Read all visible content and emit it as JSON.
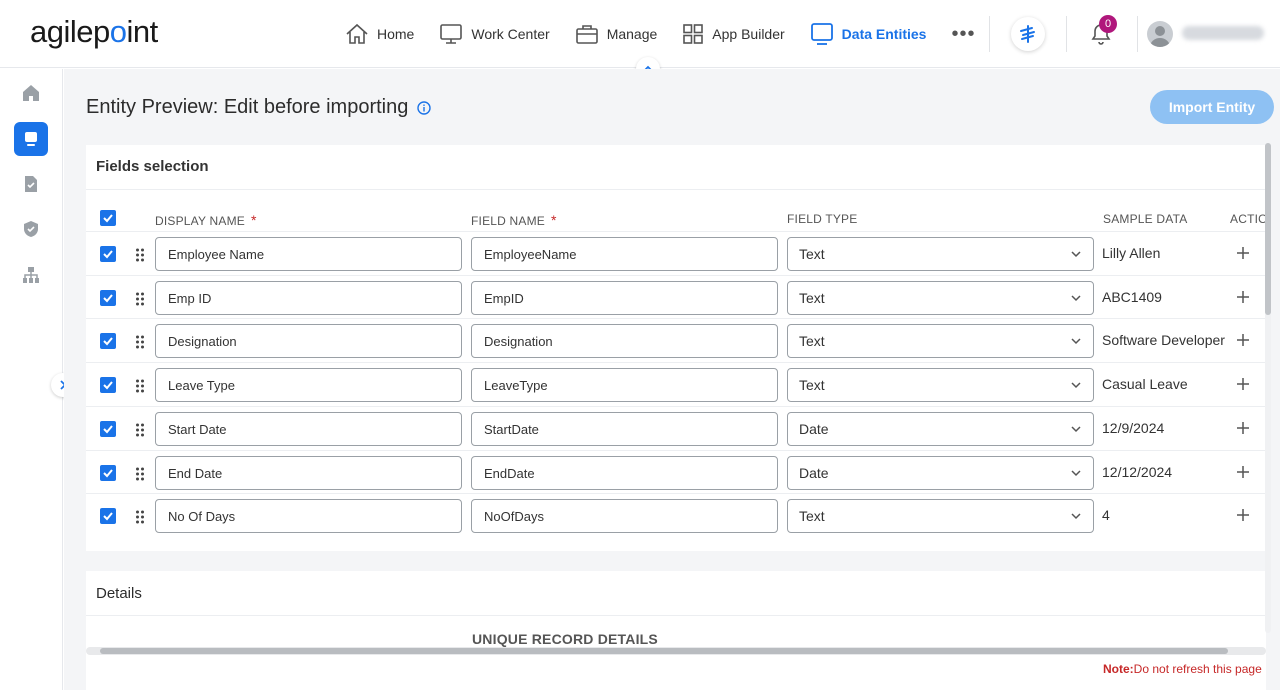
{
  "brand": {
    "name_prefix": "agilep",
    "name_suffix": "int"
  },
  "nav": {
    "items": [
      {
        "label": "Home",
        "icon": "home-icon"
      },
      {
        "label": "Work Center",
        "icon": "monitor-icon"
      },
      {
        "label": "Manage",
        "icon": "briefcase-icon"
      },
      {
        "label": "App Builder",
        "icon": "grid-icon"
      },
      {
        "label": "Data Entities",
        "icon": "data-entity-icon",
        "active": true
      }
    ],
    "more": "•••",
    "notification_count": "0"
  },
  "page": {
    "title": "Entity Preview: Edit before importing",
    "import_button": "Import Entity"
  },
  "fields_section": {
    "title": "Fields selection",
    "columns": {
      "display_name": "DISPLAY NAME",
      "field_name": "FIELD NAME",
      "field_type": "FIELD TYPE",
      "sample_data": "SAMPLE DATA",
      "actions": "ACTIO"
    },
    "rows": [
      {
        "display_name": "Employee Name",
        "field_name": "EmployeeName",
        "field_type": "Text",
        "sample": "Lilly Allen"
      },
      {
        "display_name": "Emp ID",
        "field_name": "EmpID",
        "field_type": "Text",
        "sample": "ABC1409"
      },
      {
        "display_name": "Designation",
        "field_name": "Designation",
        "field_type": "Text",
        "sample": "Software Developer"
      },
      {
        "display_name": "Leave Type",
        "field_name": "LeaveType",
        "field_type": "Text",
        "sample": "Casual Leave"
      },
      {
        "display_name": "Start Date",
        "field_name": "StartDate",
        "field_type": "Date",
        "sample": "12/9/2024"
      },
      {
        "display_name": "End Date",
        "field_name": "EndDate",
        "field_type": "Date",
        "sample": "12/12/2024"
      },
      {
        "display_name": "No Of Days",
        "field_name": "NoOfDays",
        "field_type": "Text",
        "sample": "4"
      }
    ]
  },
  "details_section": {
    "title": "Details",
    "subtitle": "UNIQUE RECORD DETAILS"
  },
  "note": {
    "label": "Note:",
    "text": "Do not refresh this page"
  },
  "colors": {
    "accent": "#1a73e8",
    "import_button": "#8ec1f3",
    "required": "#c62828",
    "badge": "#b0177c"
  }
}
